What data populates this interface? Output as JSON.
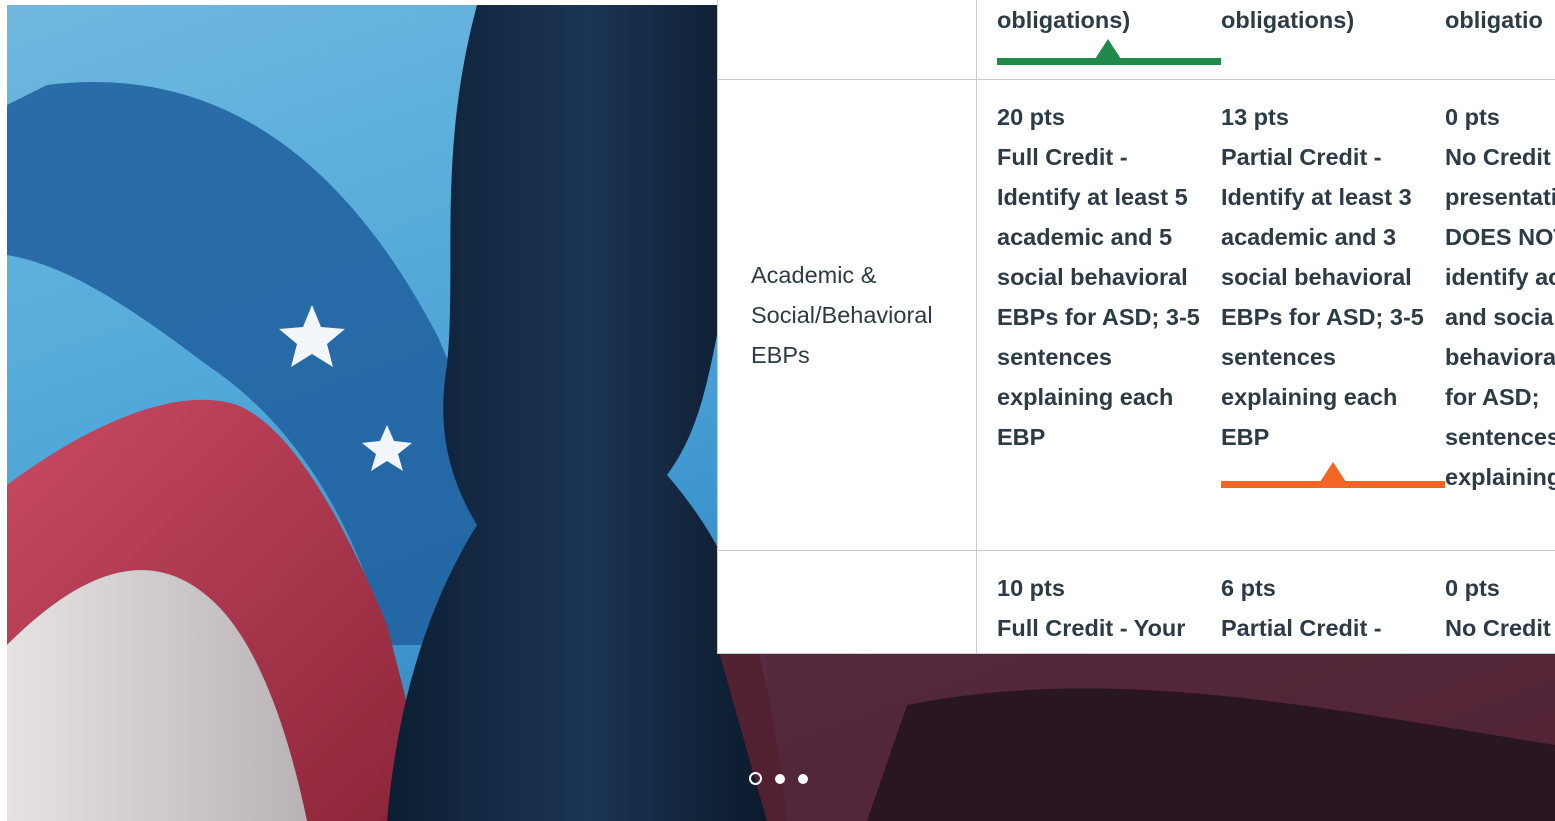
{
  "colors": {
    "selected_full": "#1f8a4c",
    "selected_partial": "#f26522",
    "text": "#2d3b45",
    "border": "#c7cdd1"
  },
  "rubric": {
    "rows": [
      {
        "criterion": "",
        "ratings": [
          {
            "pts": "",
            "desc": "obligations)"
          },
          {
            "pts": "",
            "desc": "obligations)"
          },
          {
            "pts": "",
            "desc": "obligatio"
          }
        ],
        "selected_index": 0,
        "selected_color": "green"
      },
      {
        "criterion": "Academic & Social/Behavioral EBPs",
        "ratings": [
          {
            "pts": "20 pts",
            "desc": "Full Credit - Identify at least 5 academic and 5 social behavioral EBPs for ASD; 3-5 sentences explaining each EBP"
          },
          {
            "pts": "13 pts",
            "desc": "Partial Credit - Identify at least 3 academic and 3 social behavioral EBPs for ASD; 3-5 sentences explaining each EBP"
          },
          {
            "pts": "0 pts",
            "desc": "No Credit - presentation DOES NOT identify academic and social behavioral EBPs for ASD; sentences explaining EBP"
          }
        ],
        "selected_index": 1,
        "selected_color": "orange"
      },
      {
        "criterion": "",
        "ratings": [
          {
            "pts": "10 pts",
            "desc": "Full Credit - Your"
          },
          {
            "pts": "6 pts",
            "desc": "Partial Credit -"
          },
          {
            "pts": "0 pts",
            "desc": "No Credit"
          }
        ],
        "selected_index": null
      }
    ]
  },
  "carousel": {
    "slides": 3,
    "active_index": 0
  }
}
